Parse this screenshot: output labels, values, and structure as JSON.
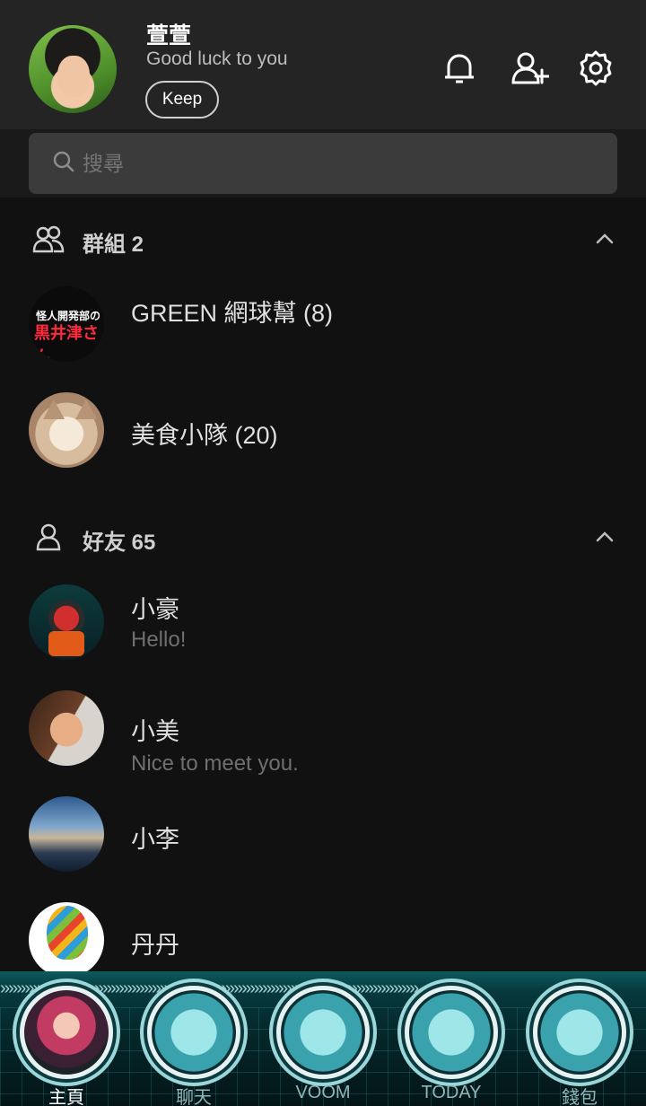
{
  "profile": {
    "name": "萱萱",
    "status": "Good luck to you",
    "keep_label": "Keep"
  },
  "header_icons": [
    "bell-icon",
    "add-friend-icon",
    "gear-icon"
  ],
  "search": {
    "placeholder": "搜尋"
  },
  "groups": {
    "title": "群組 2",
    "items": [
      {
        "name": "GREEN 網球幫 (8)",
        "avatar_text_top": "怪人開発部の",
        "avatar_text_main": "黒井津さん"
      },
      {
        "name": "美食小隊 (20)"
      }
    ]
  },
  "friends": {
    "title": "好友 65",
    "items": [
      {
        "name": "小豪",
        "status": "Hello!"
      },
      {
        "name": "小美",
        "status": "Nice to meet you."
      },
      {
        "name": "小李"
      },
      {
        "name": "丹丹"
      }
    ]
  },
  "bottom_nav": {
    "stripe": "»»»»»»»»»»»»»»»»»»»»»»»»»»»»»»»»»»»»»»»»»»»»»»»»»»»",
    "tabs": [
      {
        "label": "主頁",
        "active": true
      },
      {
        "label": "聊天"
      },
      {
        "label": "VOOM"
      },
      {
        "label": "TODAY"
      },
      {
        "label": "錢包"
      }
    ]
  },
  "colors": {
    "background": "#111111",
    "header": "#242424",
    "search_bar": "#3b3b3b",
    "nav_teal": "#0d5a5e"
  }
}
